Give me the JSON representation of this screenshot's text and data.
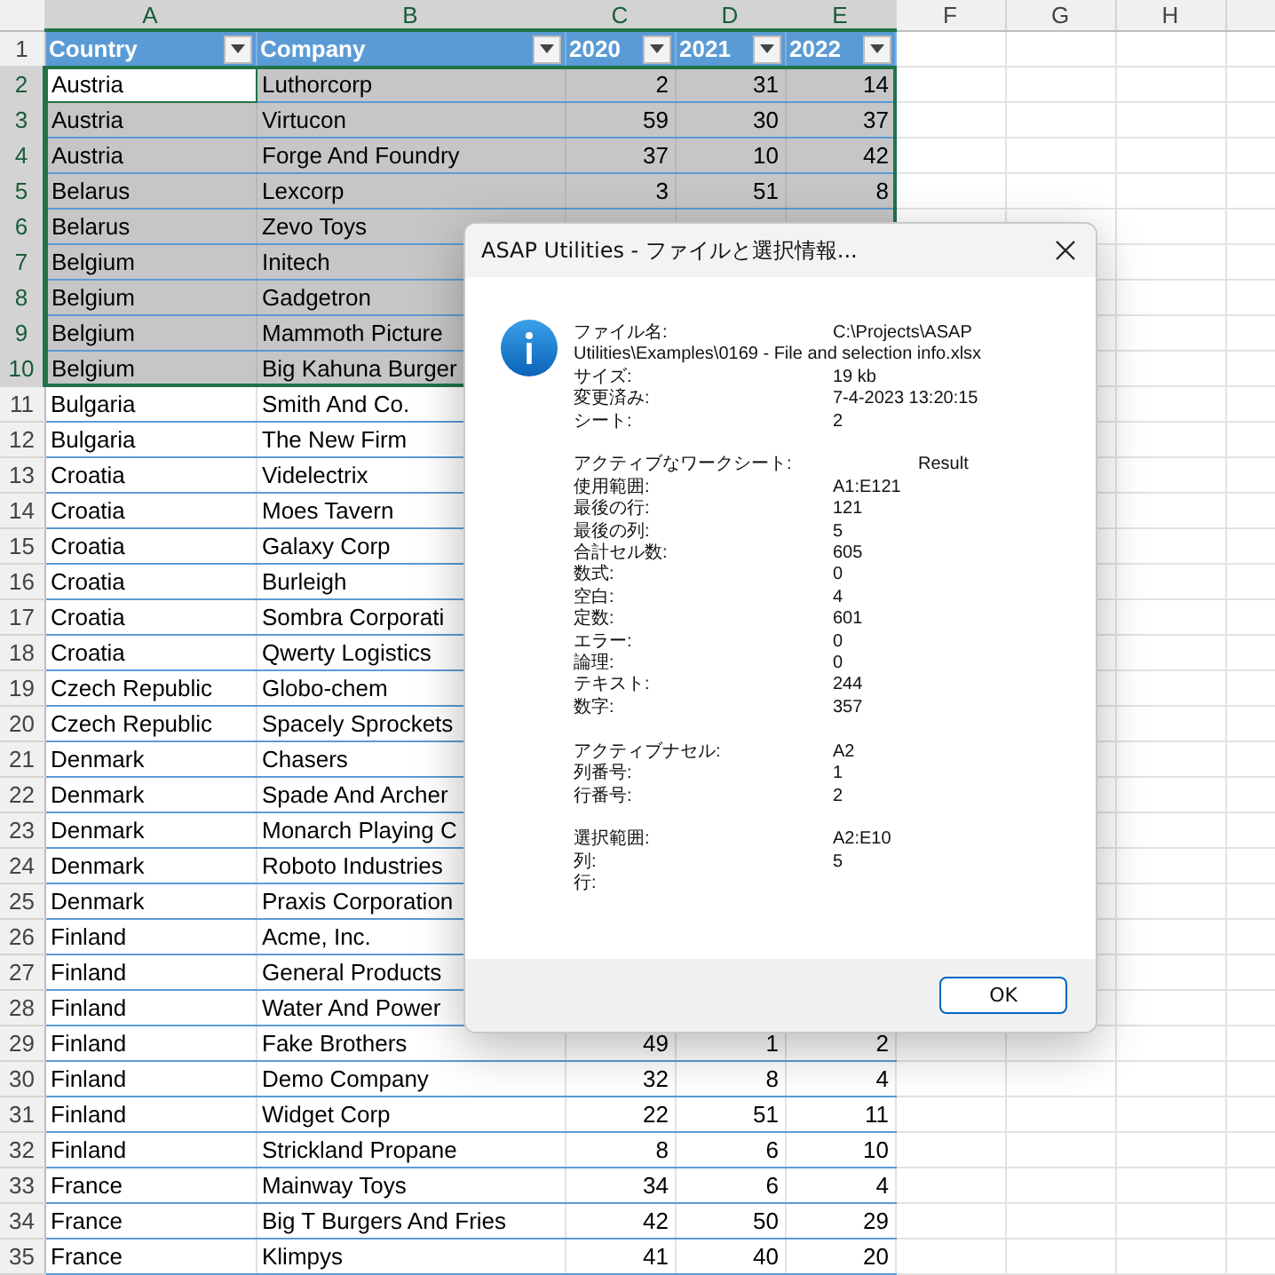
{
  "columns": [
    {
      "letter": "A",
      "selected": true
    },
    {
      "letter": "B",
      "selected": true
    },
    {
      "letter": "C",
      "selected": true
    },
    {
      "letter": "D",
      "selected": true
    },
    {
      "letter": "E",
      "selected": true
    },
    {
      "letter": "F",
      "selected": false
    },
    {
      "letter": "G",
      "selected": false
    },
    {
      "letter": "H",
      "selected": false
    }
  ],
  "table": {
    "row_number": "1",
    "headers": [
      "Country",
      "Company",
      "2020",
      "2021",
      "2022"
    ],
    "rows": [
      {
        "row_number": "2",
        "selected": true,
        "active": true,
        "cells": [
          "Austria",
          "Luthorcorp",
          "2",
          "31",
          "14"
        ]
      },
      {
        "row_number": "3",
        "selected": true,
        "active": false,
        "cells": [
          "Austria",
          "Virtucon",
          "59",
          "30",
          "37"
        ]
      },
      {
        "row_number": "4",
        "selected": true,
        "active": false,
        "cells": [
          "Austria",
          "Forge And Foundry",
          "37",
          "10",
          "42"
        ]
      },
      {
        "row_number": "5",
        "selected": true,
        "active": false,
        "cells": [
          "Belarus",
          "Lexcorp",
          "3",
          "51",
          "8"
        ]
      },
      {
        "row_number": "6",
        "selected": true,
        "active": false,
        "cells": [
          "Belarus",
          "Zevo Toys"
        ]
      },
      {
        "row_number": "7",
        "selected": true,
        "active": false,
        "cells": [
          "Belgium",
          "Initech"
        ]
      },
      {
        "row_number": "8",
        "selected": true,
        "active": false,
        "cells": [
          "Belgium",
          "Gadgetron"
        ]
      },
      {
        "row_number": "9",
        "selected": true,
        "active": false,
        "cells": [
          "Belgium",
          "Mammoth Picture"
        ]
      },
      {
        "row_number": "10",
        "selected": true,
        "active": false,
        "cells": [
          "Belgium",
          "Big Kahuna Burger"
        ]
      },
      {
        "row_number": "11",
        "selected": false,
        "active": false,
        "cells": [
          "Bulgaria",
          "Smith And Co."
        ]
      },
      {
        "row_number": "12",
        "selected": false,
        "active": false,
        "cells": [
          "Bulgaria",
          "The New Firm"
        ]
      },
      {
        "row_number": "13",
        "selected": false,
        "active": false,
        "cells": [
          "Croatia",
          "Videlectrix"
        ]
      },
      {
        "row_number": "14",
        "selected": false,
        "active": false,
        "cells": [
          "Croatia",
          "Moes Tavern"
        ]
      },
      {
        "row_number": "15",
        "selected": false,
        "active": false,
        "cells": [
          "Croatia",
          "Galaxy Corp"
        ]
      },
      {
        "row_number": "16",
        "selected": false,
        "active": false,
        "cells": [
          "Croatia",
          "Burleigh"
        ]
      },
      {
        "row_number": "17",
        "selected": false,
        "active": false,
        "cells": [
          "Croatia",
          "Sombra Corporati"
        ]
      },
      {
        "row_number": "18",
        "selected": false,
        "active": false,
        "cells": [
          "Croatia",
          "Qwerty Logistics"
        ]
      },
      {
        "row_number": "19",
        "selected": false,
        "active": false,
        "cells": [
          "Czech Republic",
          "Globo-chem"
        ]
      },
      {
        "row_number": "20",
        "selected": false,
        "active": false,
        "cells": [
          "Czech Republic",
          "Spacely Sprockets"
        ]
      },
      {
        "row_number": "21",
        "selected": false,
        "active": false,
        "cells": [
          "Denmark",
          "Chasers"
        ]
      },
      {
        "row_number": "22",
        "selected": false,
        "active": false,
        "cells": [
          "Denmark",
          "Spade And Archer"
        ]
      },
      {
        "row_number": "23",
        "selected": false,
        "active": false,
        "cells": [
          "Denmark",
          "Monarch Playing C"
        ]
      },
      {
        "row_number": "24",
        "selected": false,
        "active": false,
        "cells": [
          "Denmark",
          "Roboto Industries"
        ]
      },
      {
        "row_number": "25",
        "selected": false,
        "active": false,
        "cells": [
          "Denmark",
          "Praxis Corporation"
        ]
      },
      {
        "row_number": "26",
        "selected": false,
        "active": false,
        "cells": [
          "Finland",
          "Acme, Inc."
        ]
      },
      {
        "row_number": "27",
        "selected": false,
        "active": false,
        "cells": [
          "Finland",
          "General Products"
        ]
      },
      {
        "row_number": "28",
        "selected": false,
        "active": false,
        "cells": [
          "Finland",
          "Water And Power"
        ]
      },
      {
        "row_number": "29",
        "selected": false,
        "active": false,
        "cells": [
          "Finland",
          "Fake Brothers",
          "49",
          "1",
          "2"
        ]
      },
      {
        "row_number": "30",
        "selected": false,
        "active": false,
        "cells": [
          "Finland",
          "Demo Company",
          "32",
          "8",
          "4"
        ]
      },
      {
        "row_number": "31",
        "selected": false,
        "active": false,
        "cells": [
          "Finland",
          "Widget Corp",
          "22",
          "51",
          "11"
        ]
      },
      {
        "row_number": "32",
        "selected": false,
        "active": false,
        "cells": [
          "Finland",
          "Strickland Propane",
          "8",
          "6",
          "10"
        ]
      },
      {
        "row_number": "33",
        "selected": false,
        "active": false,
        "cells": [
          "France",
          "Mainway Toys",
          "34",
          "6",
          "4"
        ]
      },
      {
        "row_number": "34",
        "selected": false,
        "active": false,
        "cells": [
          "France",
          "Big T Burgers And Fries",
          "42",
          "50",
          "29"
        ]
      },
      {
        "row_number": "35",
        "selected": false,
        "active": false,
        "cells": [
          "France",
          "Klimpys",
          "41",
          "40",
          "20"
        ]
      }
    ]
  },
  "dialog": {
    "title": "ASAP Utilities - ファイルと選択情報...",
    "button": "OK",
    "sections": [
      [
        {
          "label": "ファイル名:",
          "value": "C:\\Projects\\ASAP"
        },
        {
          "kind": "wrap",
          "text": "Utilities\\Examples\\0169 - File and selection info.xlsx"
        },
        {
          "label": "サイズ:",
          "value": "19 kb"
        },
        {
          "label": "変更済み:",
          "value": "7-4-2023 13:20:15"
        },
        {
          "label": "シート:",
          "value": "2"
        }
      ],
      [
        {
          "label": "アクティブなワークシート:",
          "value": "Result",
          "indent": true
        },
        {
          "label": "使用範囲:",
          "value": "A1:E121"
        },
        {
          "label": "最後の行:",
          "value": "121"
        },
        {
          "label": "最後の列:",
          "value": "5"
        },
        {
          "label": "合計セル数:",
          "value": "605"
        },
        {
          "label": "数式:",
          "value": "0"
        },
        {
          "label": "空白:",
          "value": "4"
        },
        {
          "label": "定数:",
          "value": "601"
        },
        {
          "label": "エラー:",
          "value": "0"
        },
        {
          "label": "論理:",
          "value": "0"
        },
        {
          "label": "テキスト:",
          "value": "244"
        },
        {
          "label": "数字:",
          "value": "357"
        }
      ],
      [
        {
          "label": "アクティブナセル:",
          "value": "A2"
        },
        {
          "label": "列番号:",
          "value": "1"
        },
        {
          "label": "行番号:",
          "value": "2"
        }
      ],
      [
        {
          "label": "選択範囲:",
          "value": "A2:E10"
        },
        {
          "label": "列:",
          "value": "5"
        },
        {
          "label": "行:"
        }
      ]
    ]
  }
}
